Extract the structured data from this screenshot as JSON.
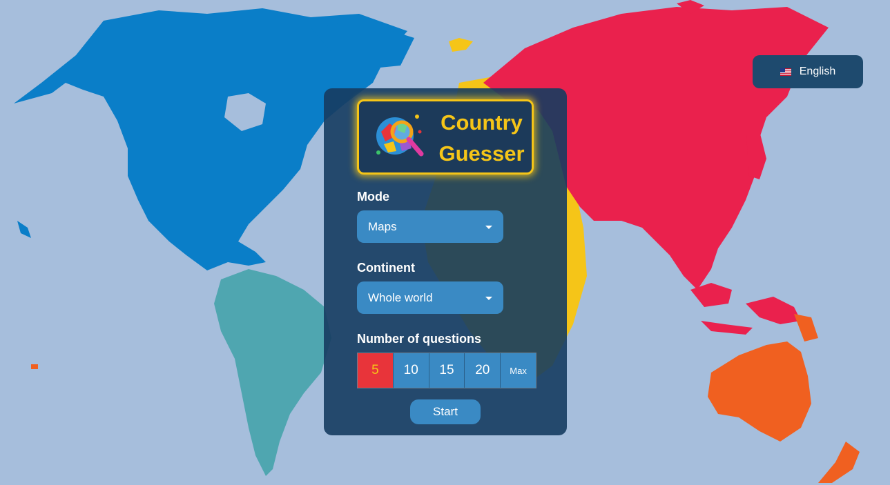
{
  "language": {
    "label": "English",
    "flag_icon": "us-flag-icon"
  },
  "logo": {
    "line1": "Country",
    "line2": "Guesser",
    "icon": "globe-magnifier-icon"
  },
  "mode": {
    "label": "Mode",
    "selected": "Maps"
  },
  "continent": {
    "label": "Continent",
    "selected": "Whole world"
  },
  "questions": {
    "label": "Number of questions",
    "options": [
      "5",
      "10",
      "15",
      "20",
      "Max"
    ],
    "selected_index": 0
  },
  "start_label": "Start",
  "colors": {
    "ocean": "#a6bedc",
    "north_america": "#0a7ec8",
    "south_america": "#4fa6b0",
    "europe_africa": "#f5c518",
    "asia": "#ea214d",
    "oceania": "#f06020",
    "panel": "#163c60",
    "accent_yellow": "#f5c518",
    "active_red": "#e8343a",
    "button_blue": "#3a8ac4"
  }
}
